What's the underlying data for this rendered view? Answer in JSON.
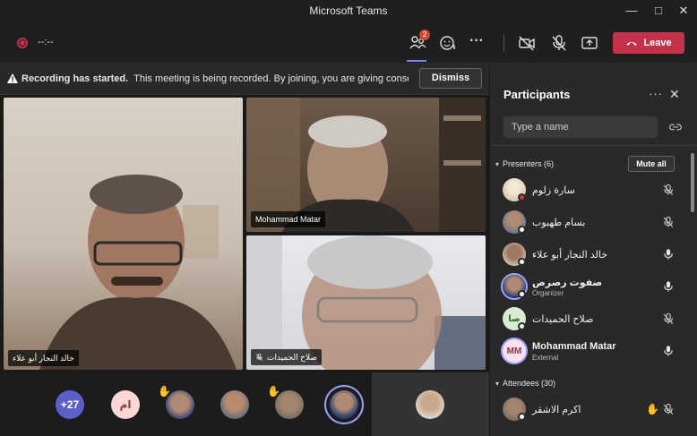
{
  "window": {
    "title": "Microsoft Teams",
    "controls": [
      "minimize-icon",
      "maximize-icon",
      "close-icon"
    ]
  },
  "toolbar": {
    "timer": "--:--",
    "participants_badge": "2",
    "leave_label": "Leave",
    "accent": "#7f85f5",
    "leave_color": "#c4314b"
  },
  "banner": {
    "title": "Recording has started.",
    "message": "This meeting is being recorded. By joining, you are giving consent fo...",
    "dismiss_label": "Dismiss"
  },
  "stage": {
    "tiles": [
      {
        "name": "خالد النجار أبو علاء"
      },
      {
        "name": "Mohammad Matar"
      },
      {
        "name": "صلاح الحميدات"
      }
    ],
    "overflow_count": "+27",
    "strip_avatars": [
      {
        "initials": "ام"
      }
    ]
  },
  "panel": {
    "title": "Participants",
    "search_placeholder": "Type a name",
    "presenters": {
      "label": "Presenters (6)",
      "mute_all_label": "Mute all",
      "people": [
        {
          "name": "سارة زلوم",
          "role": "",
          "mic": "muted"
        },
        {
          "name": "بسام طهبوب",
          "role": "",
          "mic": "muted"
        },
        {
          "name": "خالد النجار أبو علاء",
          "role": "",
          "mic": "on"
        },
        {
          "name": "صفوت رصرص",
          "role": "Organizer",
          "mic": "on"
        },
        {
          "name": "صلاح الحميدات",
          "role": "",
          "mic": "muted",
          "initials": "صا"
        },
        {
          "name": "Mohammad Matar",
          "role": "External",
          "mic": "on",
          "initials": "MM"
        }
      ]
    },
    "attendees": {
      "label": "Attendees (30)",
      "people": [
        {
          "name": "اكرم الاشقر",
          "role": "",
          "mic": "muted",
          "hand_raised": true
        }
      ]
    }
  }
}
